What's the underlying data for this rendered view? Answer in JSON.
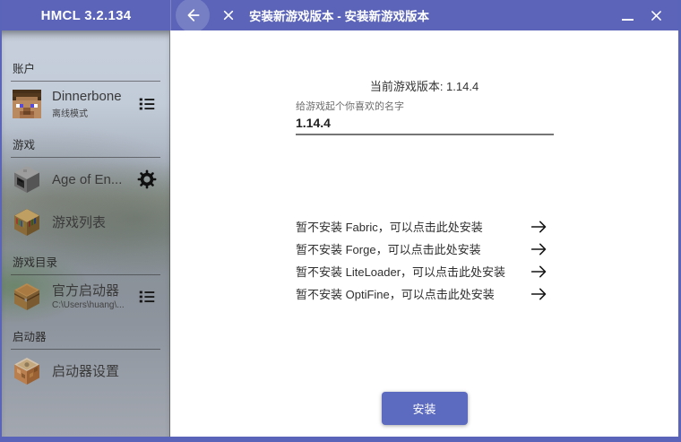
{
  "titlebar": {
    "app_title": "HMCL 3.2.134",
    "page_title": "安装新游戏版本 - 安装新游戏版本"
  },
  "sidebar": {
    "account_section": "账户",
    "account": {
      "name": "Dinnerbone",
      "mode": "离线模式"
    },
    "game_section": "游戏",
    "profile": {
      "name": "Age of En..."
    },
    "game_list": {
      "label": "游戏列表"
    },
    "dir_section": "游戏目录",
    "directory": {
      "name": "官方启动器",
      "path": "C:\\Users\\huang\\..."
    },
    "launcher_section": "启动器",
    "settings": {
      "label": "启动器设置"
    }
  },
  "main": {
    "current_version": "当前游戏版本: 1.14.4",
    "name_label": "给游戏起个你喜欢的名字",
    "name_value": "1.14.4",
    "mods": {
      "fabric": "暂不安装 Fabric，可以点击此处安装",
      "forge": "暂不安装 Forge，可以点击此处安装",
      "liteloader": "暂不安装 LiteLoader，可以点击此处安装",
      "optifine": "暂不安装 OptiFine，可以点击此处安装"
    },
    "install_label": "安装"
  },
  "icons": {
    "back": "←",
    "close": "✕",
    "minimize": "–",
    "arrow_right": "→",
    "gear": "⚙",
    "list": "☰"
  },
  "colors": {
    "titlebar": "#5b64b8",
    "accent_button": "#5c6bc0",
    "window_border": "#5a64b8"
  }
}
